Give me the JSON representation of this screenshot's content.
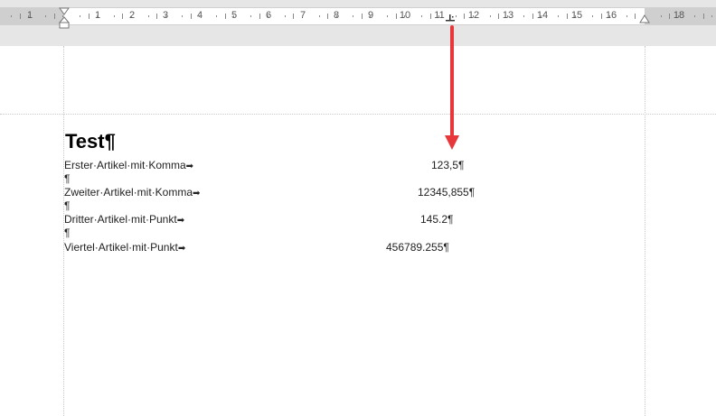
{
  "ruler": {
    "numbers_left": [
      "1"
    ],
    "numbers_right": [
      "1",
      "2",
      "3",
      "4",
      "5",
      "6",
      "7",
      "8",
      "9",
      "10",
      "11",
      "12",
      "13",
      "14",
      "15",
      "16",
      "18"
    ],
    "tab_stop_type": "decimal-tab"
  },
  "document": {
    "heading": "Test",
    "pilcrow": "¶",
    "space_dot": "·",
    "tab_arrow": "➡",
    "rows": [
      {
        "label": "Erster·Artikel·mit·Komma",
        "value": "123,5"
      },
      {
        "label": "Zweiter·Artikel·mit·Komma",
        "value": "12345,855"
      },
      {
        "label": "Dritter·Artikel·mit·Punkt",
        "value": "145.2"
      },
      {
        "label": "Viertel·Artikel·mit·Punkt",
        "value": "456789.255"
      }
    ]
  },
  "colors": {
    "annotation_arrow": "#e8373a",
    "ruler_bg": "#e6e6e6",
    "page_bg": "#ffffff"
  }
}
